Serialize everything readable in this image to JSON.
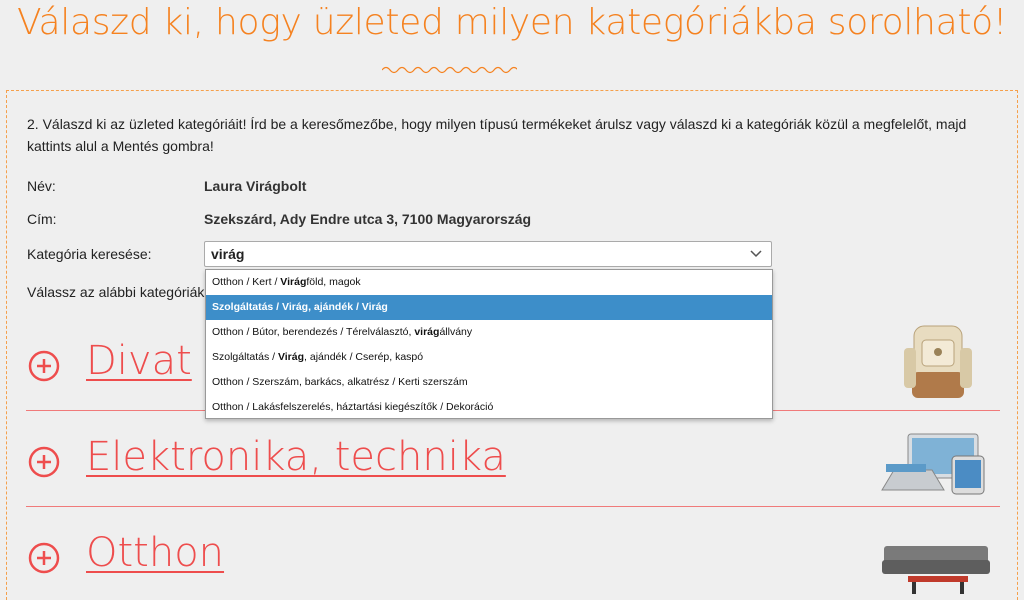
{
  "header": {
    "title": "Válaszd ki, hogy üzleted milyen kategóriákba sorolható!"
  },
  "form": {
    "intro": "2. Válaszd ki az üzleted kategóriáit! Írd be a keresőmezőbe, hogy milyen típusú termékeket árulsz vagy válaszd ki a kategóriák közül a megfelelőt, majd kattints alul a Mentés gombra!",
    "name_label": "Név:",
    "name_value": "Laura Virágbolt",
    "address_label": "Cím:",
    "address_value": "Szekszárd, Ady Endre utca 3, 7100 Magyarország",
    "search_label": "Kategória keresése:",
    "search_value": "virág",
    "choose_text": "Válassz az alábbi kategóriák közül"
  },
  "dropdown": {
    "items": [
      {
        "parts": [
          "Otthon / Kert / ",
          "Virág",
          "föld, magok"
        ],
        "bold": [
          false,
          true,
          false
        ],
        "active": false
      },
      {
        "parts": [
          "Szolgáltatás / Virág, ajándék / Virág"
        ],
        "bold": [
          true
        ],
        "active": true
      },
      {
        "parts": [
          "Otthon / Bútor, berendezés / Térelválasztó, ",
          "virág",
          "állvány"
        ],
        "bold": [
          false,
          true,
          false
        ],
        "active": false
      },
      {
        "parts": [
          "Szolgáltatás / ",
          "Virág",
          ", ajándék / Cserép, kaspó"
        ],
        "bold": [
          false,
          true,
          false
        ],
        "active": false
      },
      {
        "parts": [
          "Otthon / Szerszám, barkács, alkatrész / Kerti szerszám"
        ],
        "bold": [
          false
        ],
        "active": false
      },
      {
        "parts": [
          "Otthon / Lakásfelszerelés, háztartási kiegészítők / Dekoráció"
        ],
        "bold": [
          false
        ],
        "active": false
      }
    ]
  },
  "categories": [
    {
      "label": "Divat",
      "icon": "plus-circle-icon",
      "thumb": "backpack-image"
    },
    {
      "label": "Elektronika, technika",
      "icon": "plus-circle-icon",
      "thumb": "devices-image"
    },
    {
      "label": "Otthon",
      "icon": "plus-circle-icon",
      "thumb": "sofa-image"
    }
  ],
  "colors": {
    "title": "#f58220",
    "category": "#ee4d4d",
    "dropdown_active": "#3d8ec9"
  }
}
